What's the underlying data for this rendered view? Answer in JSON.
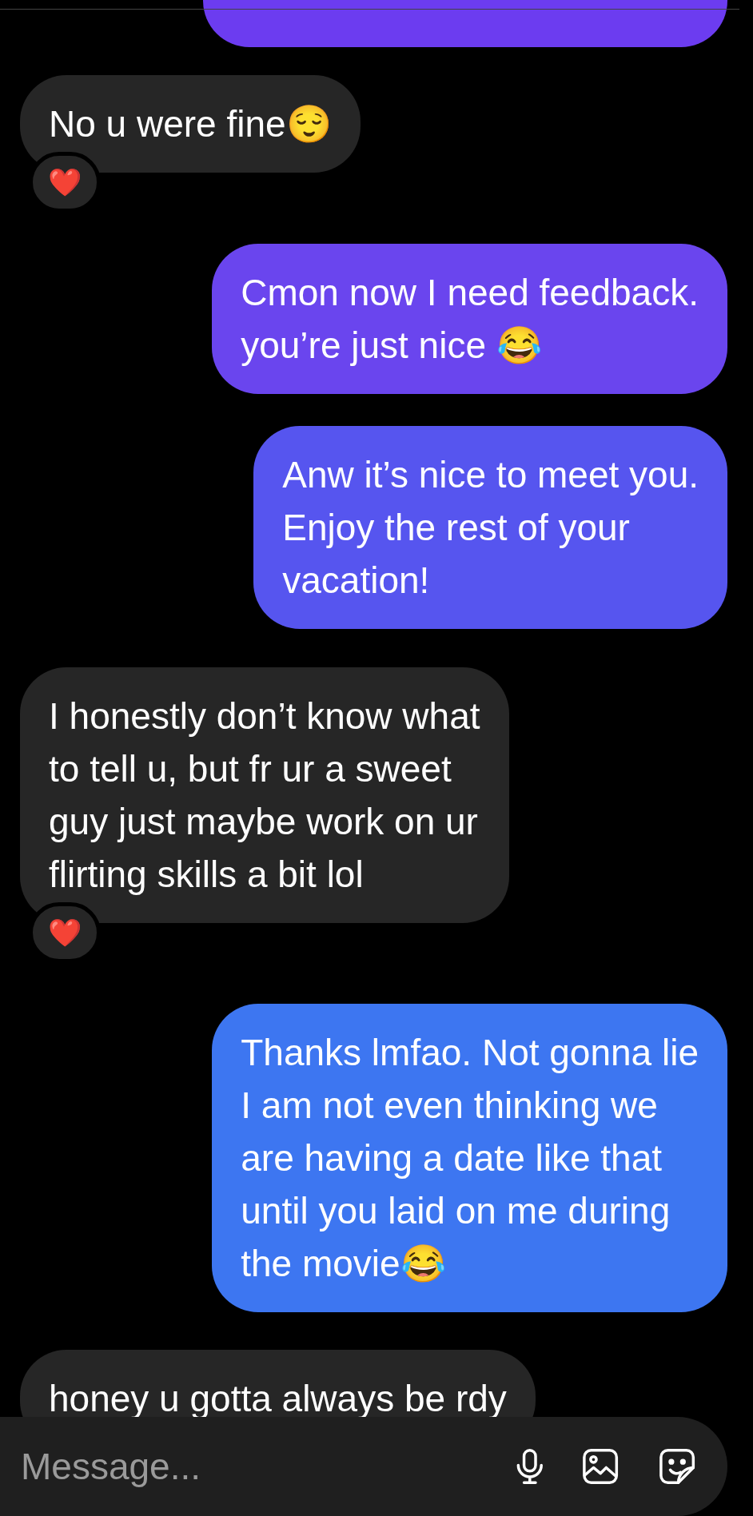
{
  "messages": [
    {
      "kind": "sent",
      "color": "#6c3cf0"
    },
    {
      "kind": "received",
      "text": "No u were fine😌",
      "reaction": "❤️"
    },
    {
      "kind": "sent",
      "color": "#6a45ee",
      "text": "Cmon now I need feedback.\nyou’re just nice 😂"
    },
    {
      "kind": "sent",
      "color": "#5655ef",
      "text": "Anw it’s nice to meet you.\nEnjoy the rest of your\nvacation!"
    },
    {
      "kind": "received",
      "text": "I honestly don’t know what\nto tell u, but fr ur a sweet\nguy just maybe work on ur\nflirting skills a bit lol",
      "reaction": "❤️"
    },
    {
      "kind": "sent",
      "color": "#3d76f1",
      "text": "Thanks lmfao. Not gonna lie\nI am not even thinking we\nare having a date like that\nuntil you laid on me during\nthe movie😂"
    },
    {
      "kind": "received",
      "text": "honey u gotta always be rdy"
    }
  ],
  "composer": {
    "placeholder": "Message..."
  }
}
